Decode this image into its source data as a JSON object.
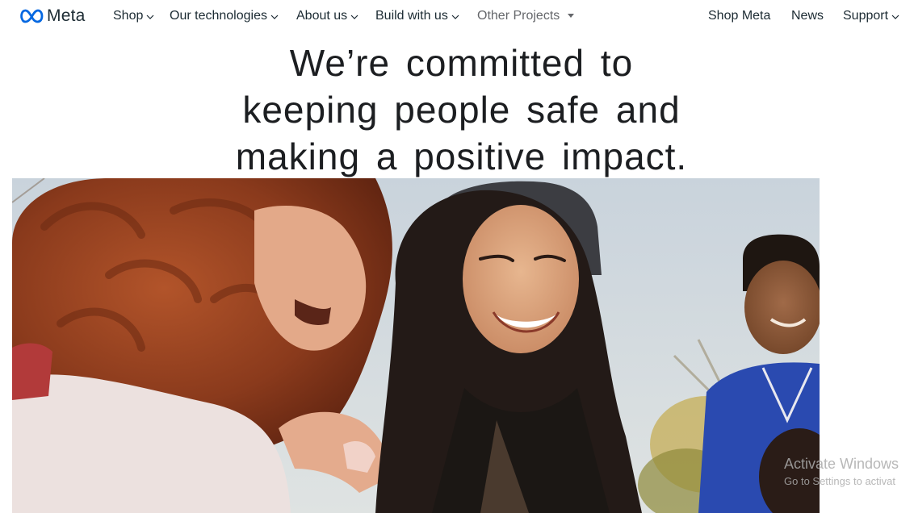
{
  "brand": {
    "logo_icon": "meta-infinity-logo-icon",
    "name": "Meta",
    "color": "#0668E1"
  },
  "nav": {
    "left_items": [
      {
        "label": "Shop",
        "icon": "chevron-down-icon"
      },
      {
        "label": "Our technologies",
        "icon": "chevron-down-icon"
      },
      {
        "label": "About us",
        "icon": "chevron-down-icon"
      },
      {
        "label": "Build with us",
        "icon": "chevron-down-icon"
      },
      {
        "label": "Other Projects",
        "icon": "caret-down-icon"
      }
    ],
    "right_items": [
      {
        "label": "Shop Meta"
      },
      {
        "label": "News"
      },
      {
        "label": "Support",
        "icon": "chevron-down-icon"
      }
    ]
  },
  "hero": {
    "headline_lines": [
      "We’re committed to",
      "keeping people safe and",
      "making a positive impact."
    ]
  },
  "watermark": {
    "title": "Activate Windows",
    "subtitle": "Go to Settings to activat"
  },
  "colors": {
    "text": "#1c2b33",
    "muted_text": "#65676b",
    "background": "#ffffff"
  }
}
